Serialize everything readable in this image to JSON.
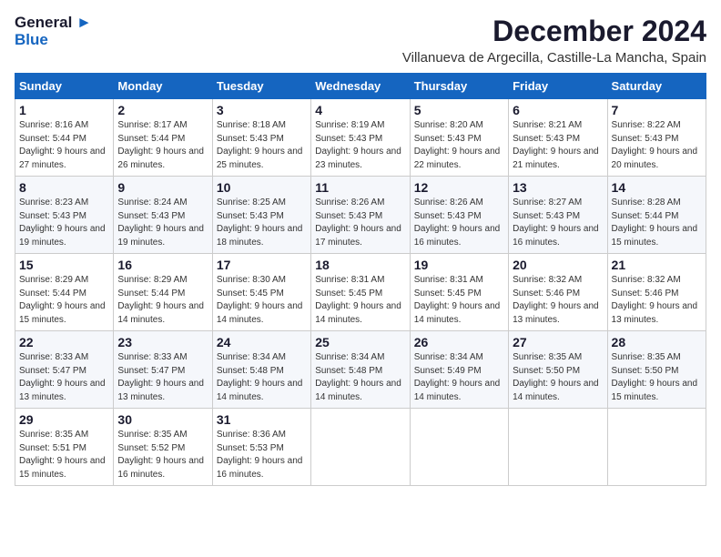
{
  "logo": {
    "line1": "General",
    "line2": "Blue"
  },
  "title": "December 2024",
  "subtitle": "Villanueva de Argecilla, Castille-La Mancha, Spain",
  "days_header": [
    "Sunday",
    "Monday",
    "Tuesday",
    "Wednesday",
    "Thursday",
    "Friday",
    "Saturday"
  ],
  "weeks": [
    [
      {
        "day": "1",
        "sunrise": "8:16 AM",
        "sunset": "5:44 PM",
        "daylight": "9 hours and 27 minutes."
      },
      {
        "day": "2",
        "sunrise": "8:17 AM",
        "sunset": "5:44 PM",
        "daylight": "9 hours and 26 minutes."
      },
      {
        "day": "3",
        "sunrise": "8:18 AM",
        "sunset": "5:43 PM",
        "daylight": "9 hours and 25 minutes."
      },
      {
        "day": "4",
        "sunrise": "8:19 AM",
        "sunset": "5:43 PM",
        "daylight": "9 hours and 23 minutes."
      },
      {
        "day": "5",
        "sunrise": "8:20 AM",
        "sunset": "5:43 PM",
        "daylight": "9 hours and 22 minutes."
      },
      {
        "day": "6",
        "sunrise": "8:21 AM",
        "sunset": "5:43 PM",
        "daylight": "9 hours and 21 minutes."
      },
      {
        "day": "7",
        "sunrise": "8:22 AM",
        "sunset": "5:43 PM",
        "daylight": "9 hours and 20 minutes."
      }
    ],
    [
      {
        "day": "8",
        "sunrise": "8:23 AM",
        "sunset": "5:43 PM",
        "daylight": "9 hours and 19 minutes."
      },
      {
        "day": "9",
        "sunrise": "8:24 AM",
        "sunset": "5:43 PM",
        "daylight": "9 hours and 19 minutes."
      },
      {
        "day": "10",
        "sunrise": "8:25 AM",
        "sunset": "5:43 PM",
        "daylight": "9 hours and 18 minutes."
      },
      {
        "day": "11",
        "sunrise": "8:26 AM",
        "sunset": "5:43 PM",
        "daylight": "9 hours and 17 minutes."
      },
      {
        "day": "12",
        "sunrise": "8:26 AM",
        "sunset": "5:43 PM",
        "daylight": "9 hours and 16 minutes."
      },
      {
        "day": "13",
        "sunrise": "8:27 AM",
        "sunset": "5:43 PM",
        "daylight": "9 hours and 16 minutes."
      },
      {
        "day": "14",
        "sunrise": "8:28 AM",
        "sunset": "5:44 PM",
        "daylight": "9 hours and 15 minutes."
      }
    ],
    [
      {
        "day": "15",
        "sunrise": "8:29 AM",
        "sunset": "5:44 PM",
        "daylight": "9 hours and 15 minutes."
      },
      {
        "day": "16",
        "sunrise": "8:29 AM",
        "sunset": "5:44 PM",
        "daylight": "9 hours and 14 minutes."
      },
      {
        "day": "17",
        "sunrise": "8:30 AM",
        "sunset": "5:45 PM",
        "daylight": "9 hours and 14 minutes."
      },
      {
        "day": "18",
        "sunrise": "8:31 AM",
        "sunset": "5:45 PM",
        "daylight": "9 hours and 14 minutes."
      },
      {
        "day": "19",
        "sunrise": "8:31 AM",
        "sunset": "5:45 PM",
        "daylight": "9 hours and 14 minutes."
      },
      {
        "day": "20",
        "sunrise": "8:32 AM",
        "sunset": "5:46 PM",
        "daylight": "9 hours and 13 minutes."
      },
      {
        "day": "21",
        "sunrise": "8:32 AM",
        "sunset": "5:46 PM",
        "daylight": "9 hours and 13 minutes."
      }
    ],
    [
      {
        "day": "22",
        "sunrise": "8:33 AM",
        "sunset": "5:47 PM",
        "daylight": "9 hours and 13 minutes."
      },
      {
        "day": "23",
        "sunrise": "8:33 AM",
        "sunset": "5:47 PM",
        "daylight": "9 hours and 13 minutes."
      },
      {
        "day": "24",
        "sunrise": "8:34 AM",
        "sunset": "5:48 PM",
        "daylight": "9 hours and 14 minutes."
      },
      {
        "day": "25",
        "sunrise": "8:34 AM",
        "sunset": "5:48 PM",
        "daylight": "9 hours and 14 minutes."
      },
      {
        "day": "26",
        "sunrise": "8:34 AM",
        "sunset": "5:49 PM",
        "daylight": "9 hours and 14 minutes."
      },
      {
        "day": "27",
        "sunrise": "8:35 AM",
        "sunset": "5:50 PM",
        "daylight": "9 hours and 14 minutes."
      },
      {
        "day": "28",
        "sunrise": "8:35 AM",
        "sunset": "5:50 PM",
        "daylight": "9 hours and 15 minutes."
      }
    ],
    [
      {
        "day": "29",
        "sunrise": "8:35 AM",
        "sunset": "5:51 PM",
        "daylight": "9 hours and 15 minutes."
      },
      {
        "day": "30",
        "sunrise": "8:35 AM",
        "sunset": "5:52 PM",
        "daylight": "9 hours and 16 minutes."
      },
      {
        "day": "31",
        "sunrise": "8:36 AM",
        "sunset": "5:53 PM",
        "daylight": "9 hours and 16 minutes."
      },
      null,
      null,
      null,
      null
    ]
  ]
}
